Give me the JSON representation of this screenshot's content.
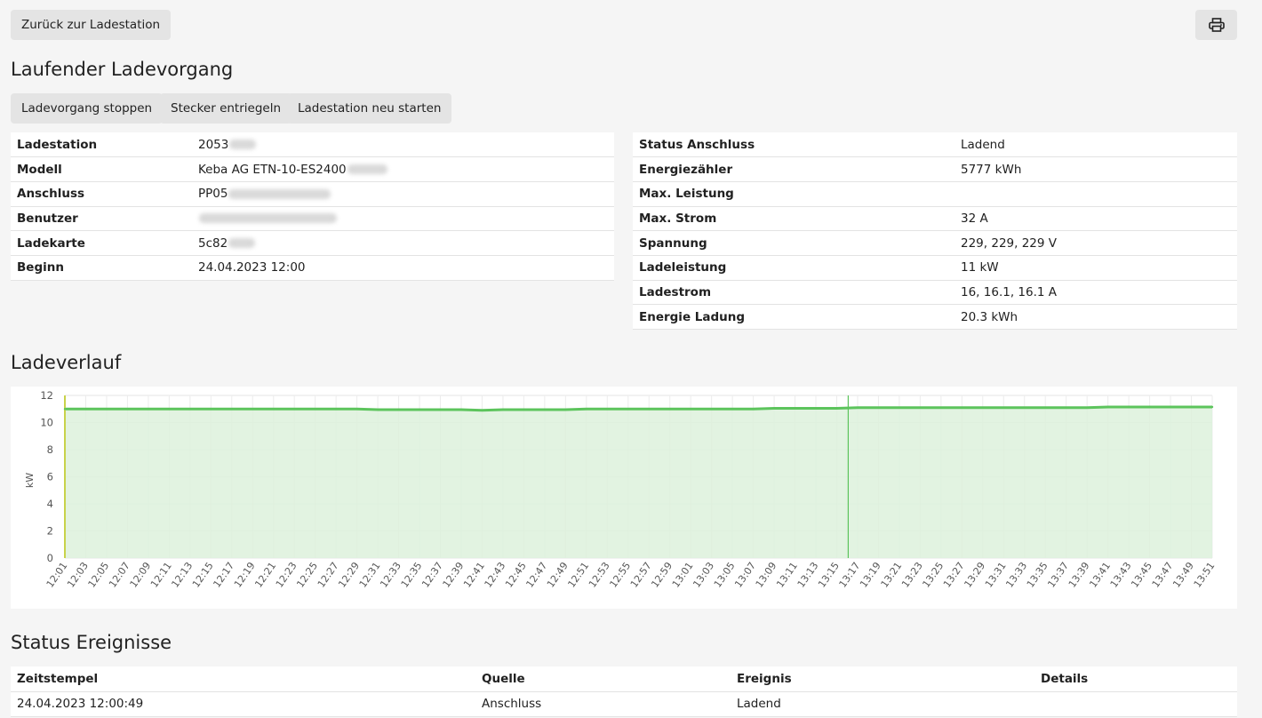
{
  "header": {
    "back_label": "Zurück zur Ladestation",
    "print_icon": "printer-icon"
  },
  "title": "Laufender Ladevorgang",
  "actions": {
    "stop_label": "Ladevorgang stoppen",
    "unlock_label": "Stecker entriegeln",
    "restart_label": "Ladestation neu starten"
  },
  "session_info": [
    {
      "label": "Ladestation",
      "value": "2053"
    },
    {
      "label": "Modell",
      "value": "Keba AG ETN-10-ES2400"
    },
    {
      "label": "Anschluss",
      "value": "PP05"
    },
    {
      "label": "Benutzer",
      "value": ""
    },
    {
      "label": "Ladekarte",
      "value": "5c82"
    },
    {
      "label": "Beginn",
      "value": "24.04.2023 12:00"
    }
  ],
  "connector_info": [
    {
      "label": "Status Anschluss",
      "value": "Ladend"
    },
    {
      "label": "Energiezähler",
      "value": "5777 kWh"
    },
    {
      "label": "Max. Leistung",
      "value": ""
    },
    {
      "label": "Max. Strom",
      "value": "32 A"
    },
    {
      "label": "Spannung",
      "value": "229, 229, 229 V"
    },
    {
      "label": "Ladeleistung",
      "value": "11 kW"
    },
    {
      "label": "Ladestrom",
      "value": "16, 16.1, 16.1 A"
    },
    {
      "label": "Energie Ladung",
      "value": "20.3 kWh"
    }
  ],
  "chart_title": "Ladeverlauf",
  "chart_data": {
    "type": "area",
    "ylabel": "kW",
    "ylim": [
      0,
      12
    ],
    "yticks": [
      0,
      2,
      4,
      6,
      8,
      10,
      12
    ],
    "x": [
      "12:01",
      "12:03",
      "12:05",
      "12:07",
      "12:09",
      "12:11",
      "12:13",
      "12:15",
      "12:17",
      "12:19",
      "12:21",
      "12:23",
      "12:25",
      "12:27",
      "12:29",
      "12:31",
      "12:33",
      "12:35",
      "12:37",
      "12:39",
      "12:41",
      "12:43",
      "12:45",
      "12:47",
      "12:49",
      "12:51",
      "12:53",
      "12:55",
      "12:57",
      "12:59",
      "13:01",
      "13:03",
      "13:05",
      "13:07",
      "13:09",
      "13:11",
      "13:13",
      "13:15",
      "13:17",
      "13:19",
      "13:21",
      "13:23",
      "13:25",
      "13:27",
      "13:29",
      "13:31",
      "13:33",
      "13:35",
      "13:37",
      "13:39",
      "13:41",
      "13:43",
      "13:45",
      "13:47",
      "13:49",
      "13:51"
    ],
    "values": [
      11.0,
      11.0,
      11.0,
      11.0,
      11.0,
      11.0,
      11.0,
      11.0,
      11.0,
      11.0,
      11.0,
      11.0,
      11.0,
      11.0,
      11.0,
      10.95,
      10.95,
      10.95,
      10.95,
      10.95,
      10.9,
      10.95,
      10.95,
      10.95,
      10.95,
      11.0,
      11.0,
      11.0,
      11.0,
      11.0,
      11.0,
      11.0,
      11.0,
      11.0,
      11.05,
      11.05,
      11.05,
      11.05,
      11.1,
      11.1,
      11.1,
      11.1,
      11.1,
      11.1,
      11.1,
      11.1,
      11.1,
      11.1,
      11.1,
      11.1,
      11.15,
      11.15,
      11.15,
      11.15,
      11.15,
      11.15
    ],
    "colors": {
      "line": "#5cc45c",
      "fill": "#ddf1dc",
      "marker_start": "#c8d24a",
      "marker": "#5cc45c"
    },
    "grid": true
  },
  "events_title": "Status Ereignisse",
  "events": {
    "headers": [
      "Zeitstempel",
      "Quelle",
      "Ereignis",
      "Details"
    ],
    "rows": [
      [
        "24.04.2023 12:00:49",
        "Anschluss",
        "Ladend",
        ""
      ]
    ]
  }
}
